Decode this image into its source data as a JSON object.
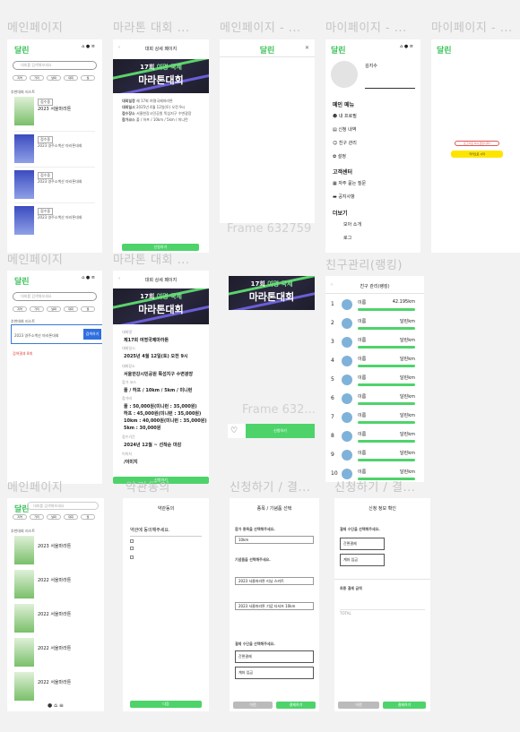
{
  "labels": {
    "r1": [
      "메인페이지",
      "마라톤 대회 ...",
      "메인페이지 - ...",
      "마이페이지 - ...",
      "마이페이지 - ..."
    ],
    "r2": [
      "메인페이지",
      "마라톤 대회 ...",
      "친구관리(랭킹)"
    ],
    "r3": [
      "메인페이지",
      "약관동의",
      "신청하기 / 결...",
      "신청하기 / 결..."
    ],
    "frame_a": "Frame 632759",
    "frame_b": "Frame 632..."
  },
  "app": {
    "logo": "달린",
    "search_placeholder": "대회를 검색해보세요",
    "filters": [
      "지역",
      "거리",
      "날짜",
      "대회",
      "월"
    ],
    "section": "추천대회 리스트"
  },
  "cards": [
    {
      "title": "2023 서울마라톤",
      "tag": "접수중"
    },
    {
      "title": "2023 영주소백산 마라톤대회",
      "tag": "접수중"
    },
    {
      "title": "2023 영주소백산 마라톤대회",
      "tag": "접수중"
    },
    {
      "title": "2023 영주소백산 마라톤대회",
      "tag": "접수중"
    }
  ],
  "detail": {
    "header": "대회 상세 페이지",
    "banner_small": "17회",
    "banner_title": "마라톤대회",
    "banner_big": "여명 국제",
    "rows": [
      {
        "k": "대회일정",
        "v": "제 17회 여명국제마라톤"
      },
      {
        "k": "대회일시",
        "v": "2025년 4월 12일(토) 오전 9시"
      },
      {
        "k": "접수장소",
        "v": "서울한강시민공원 뚝섬지구 수변광장"
      },
      {
        "k": "참가코스",
        "v": "풀 / 하프 / 10km / 5km / 미니런"
      }
    ],
    "apply": "신청하기"
  },
  "detail2": {
    "name_label": "대회명",
    "name": "제17회 여명국제마라톤",
    "date_label": "대회일시",
    "date": "2025년 4월 12일(토) 오전 9시",
    "place_label": "대회장소",
    "place": "서울한강시민공원 뚝섬지구 수변광장",
    "course_label": "참가 코스",
    "course": "풀 / 하프 / 10km / 5km / 미니런",
    "fee_label": "참가비",
    "fee": [
      "풀 : 50,000원(미니런 : 35,000원)",
      "하프 : 45,000원(미니런 : 35,000원)",
      "10km : 40,000원(미니런 : 35,000원)",
      "5km : 30,000원"
    ],
    "period_label": "접수기간",
    "period": "2024년 12월 ~ 선착순 마감",
    "img_label": "이미지",
    "img": "/이미지"
  },
  "mypage": {
    "name": "김지수",
    "menu_head": "메인 메뉴",
    "menu": [
      "내 프로필",
      "신청 내역",
      "친구 관리",
      "설정"
    ],
    "cs_head": "고객센터",
    "cs": [
      "자주 묻는 질문",
      "공지사항"
    ],
    "more_head": "더보기",
    "more": [
      "모아 소개",
      "로그"
    ]
  },
  "logout": {
    "warn": "로그아웃 하시겠습니까?",
    "btn": "카카오로 시작"
  },
  "ranking": {
    "header": "친구 관리(랭킹)",
    "rows": [
      {
        "n": "1",
        "name": "이름",
        "km": "42.195km"
      },
      {
        "n": "2",
        "name": "이름",
        "km": "달린km"
      },
      {
        "n": "3",
        "name": "이름",
        "km": "달린km"
      },
      {
        "n": "4",
        "name": "이름",
        "km": "달린km"
      },
      {
        "n": "5",
        "name": "이름",
        "km": "달린km"
      },
      {
        "n": "6",
        "name": "이름",
        "km": "달린km"
      },
      {
        "n": "7",
        "name": "이름",
        "km": "달린km"
      },
      {
        "n": "8",
        "name": "이름",
        "km": "달린km"
      },
      {
        "n": "9",
        "name": "이름",
        "km": "달린km"
      },
      {
        "n": "10",
        "name": "이름",
        "km": "달린km"
      }
    ]
  },
  "search_result": {
    "title": "2023 영주소백산 마라톤대회",
    "btn": "검색하기",
    "note": "검색결과 8개"
  },
  "list3": [
    {
      "title": "2023 서울마라톤"
    },
    {
      "title": "2022 서울마라톤"
    },
    {
      "title": "2022 서울마라톤"
    },
    {
      "title": "2022 서울마라톤"
    },
    {
      "title": "2022 서울마라톤"
    }
  ],
  "terms": {
    "header": "약관동의",
    "title": "약관에 동의해주세요.",
    "btn": "다음"
  },
  "apply1": {
    "header": "종목 / 기념품 선택",
    "q1": "참가 종목을 선택해주세요.",
    "v1": "10km",
    "q2": "기념품을 선택해주세요.",
    "v2": "2023 서울마라톤 러닝 스커트",
    "v3": "2023 서울마라톤 기념 티셔츠 10km",
    "q3": "결제 수단을 선택해주세요.",
    "pay1": "간편결제",
    "pay2": "계좌 입금",
    "prev": "이전",
    "next": "결제하기"
  },
  "apply2": {
    "header": "신청 정보 확인",
    "q": "결제 수단을 선택해주세요.",
    "pay1": "간편결제",
    "pay2": "계좌 입금",
    "sum_title": "최종 결제 금액",
    "total": "TOTAL",
    "prev": "이전",
    "next": "결제하기"
  }
}
